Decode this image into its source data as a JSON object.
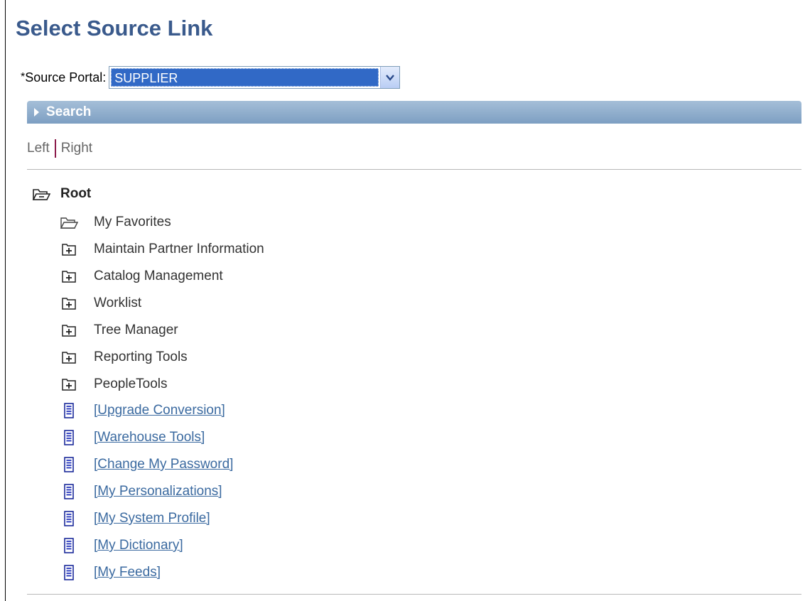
{
  "page": {
    "title": "Select Source Link"
  },
  "source_portal": {
    "required_marker": "*",
    "label": "Source Portal:",
    "value": "SUPPLIER"
  },
  "search": {
    "label": "Search"
  },
  "view_toggle": {
    "left": "Left",
    "right": "Right"
  },
  "tree": {
    "root": "Root",
    "open_folders": [
      "My Favorites"
    ],
    "folders": [
      "Maintain Partner Information",
      "Catalog Management",
      "Worklist",
      "Tree Manager",
      "Reporting Tools",
      "PeopleTools"
    ],
    "links": [
      "[Upgrade Conversion]",
      "[Warehouse Tools]",
      "[Change My Password]",
      "[My Personalizations]",
      "[My System Profile]",
      "[My Dictionary]",
      "[My Feeds]"
    ]
  },
  "icons": {
    "open_folder": "folder-open-icon",
    "closed_folder": "folder-plus-icon",
    "content": "content-page-icon",
    "dropdown": "chevron-down-icon",
    "expand": "triangle-right-icon"
  },
  "colors": {
    "title": "#3a5a8c",
    "link": "#3b6aa0",
    "selection": "#3169c6",
    "section_bar": "#8fadcd"
  }
}
